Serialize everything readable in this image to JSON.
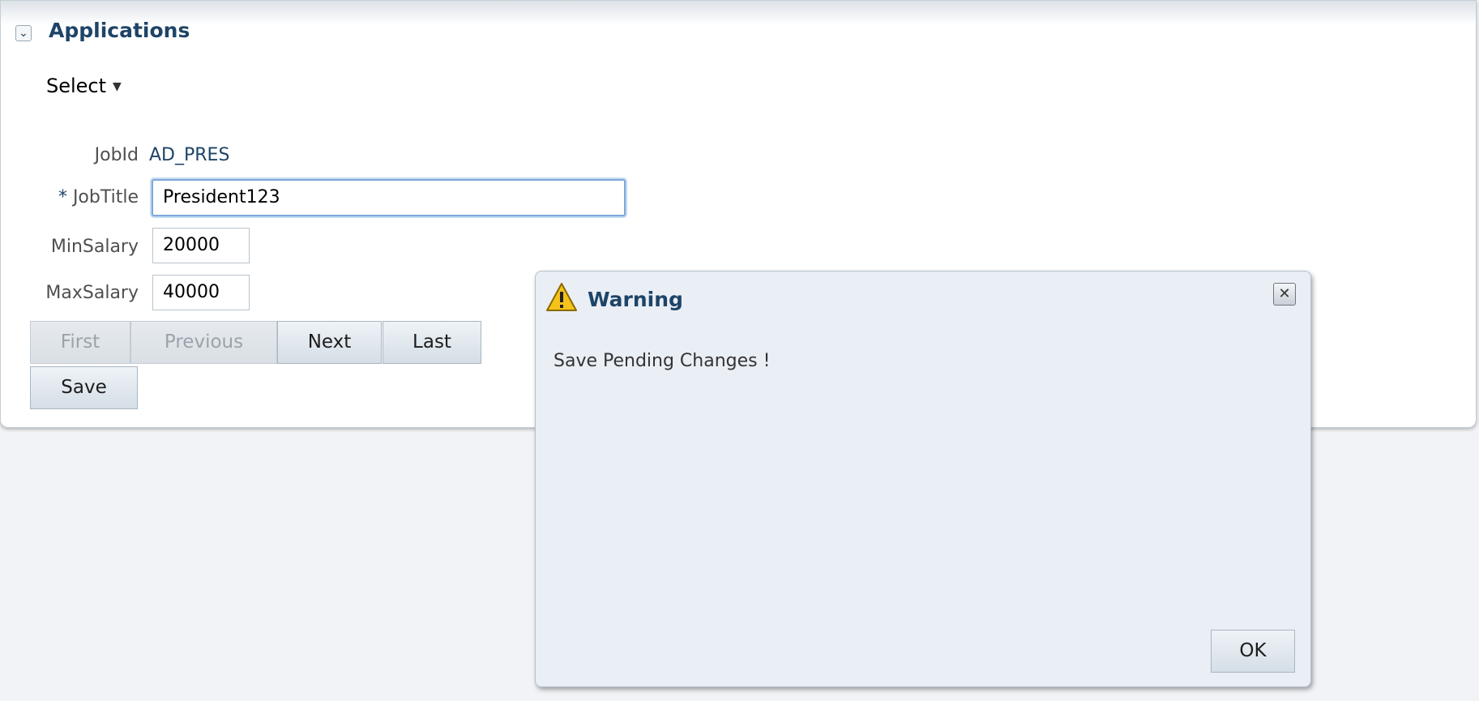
{
  "panel": {
    "title": "Applications",
    "disclose_icon": "chevron-down-icon",
    "select_menu": "Select"
  },
  "form": {
    "jobid": {
      "label": "JobId",
      "value": "AD_PRES"
    },
    "jobtitle": {
      "required_marker": "*",
      "label": "JobTitle",
      "value": "President123"
    },
    "minsalary": {
      "label": "MinSalary",
      "value": "20000"
    },
    "maxsalary": {
      "label": "MaxSalary",
      "value": "40000"
    }
  },
  "nav_buttons": {
    "first": "First",
    "previous": "Previous",
    "next": "Next",
    "last": "Last",
    "save": "Save"
  },
  "dialog": {
    "icon": "warning-icon",
    "title": "Warning",
    "message": "Save Pending Changes !",
    "close_icon": "close-icon",
    "ok": "OK"
  },
  "colors": {
    "title": "#1e4467",
    "focus_ring": "#7ea7d8",
    "warning_yellow": "#f4c21a"
  }
}
